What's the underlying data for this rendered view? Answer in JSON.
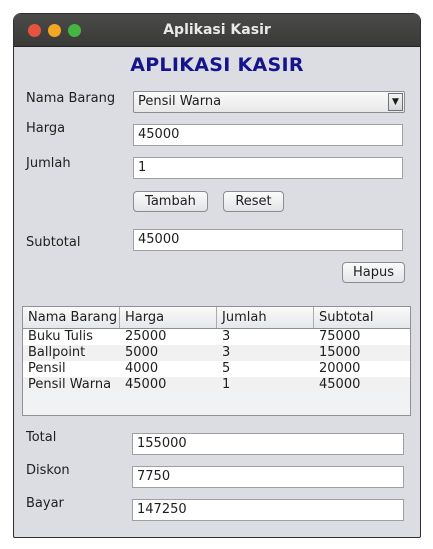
{
  "window": {
    "title": "Aplikasi Kasir"
  },
  "heading": "APLIKASI KASIR",
  "form": {
    "nama_barang_label": "Nama Barang",
    "nama_barang_value": "Pensil Warna",
    "harga_label": "Harga",
    "harga_value": "45000",
    "jumlah_label": "Jumlah",
    "jumlah_value": "1",
    "tambah_label": "Tambah",
    "reset_label": "Reset",
    "subtotal_label": "Subtotal",
    "subtotal_value": "45000",
    "hapus_label": "Hapus"
  },
  "table": {
    "headers": [
      "Nama Barang",
      "Harga",
      "Jumlah",
      "Subtotal"
    ],
    "rows": [
      [
        "Buku Tulis",
        "25000",
        "3",
        "75000"
      ],
      [
        "Ballpoint",
        "5000",
        "3",
        "15000"
      ],
      [
        "Pensil",
        "4000",
        "5",
        "20000"
      ],
      [
        "Pensil Warna",
        "45000",
        "1",
        "45000"
      ]
    ]
  },
  "summary": {
    "total_label": "Total",
    "total_value": "155000",
    "diskon_label": "Diskon",
    "diskon_value": "7750",
    "bayar_label": "Bayar",
    "bayar_value": "147250"
  },
  "icons": {
    "close": "close-dot-icon",
    "minimize": "minimize-dot-icon",
    "maximize": "maximize-dot-icon",
    "dropdown": "triangle-down-icon"
  },
  "colors": {
    "heading": "#14148c",
    "titlebar": "#3c3c3a",
    "window_bg": "#dcdde3",
    "close": "#e8533f",
    "minimize": "#f5a623",
    "maximize": "#45b542"
  }
}
